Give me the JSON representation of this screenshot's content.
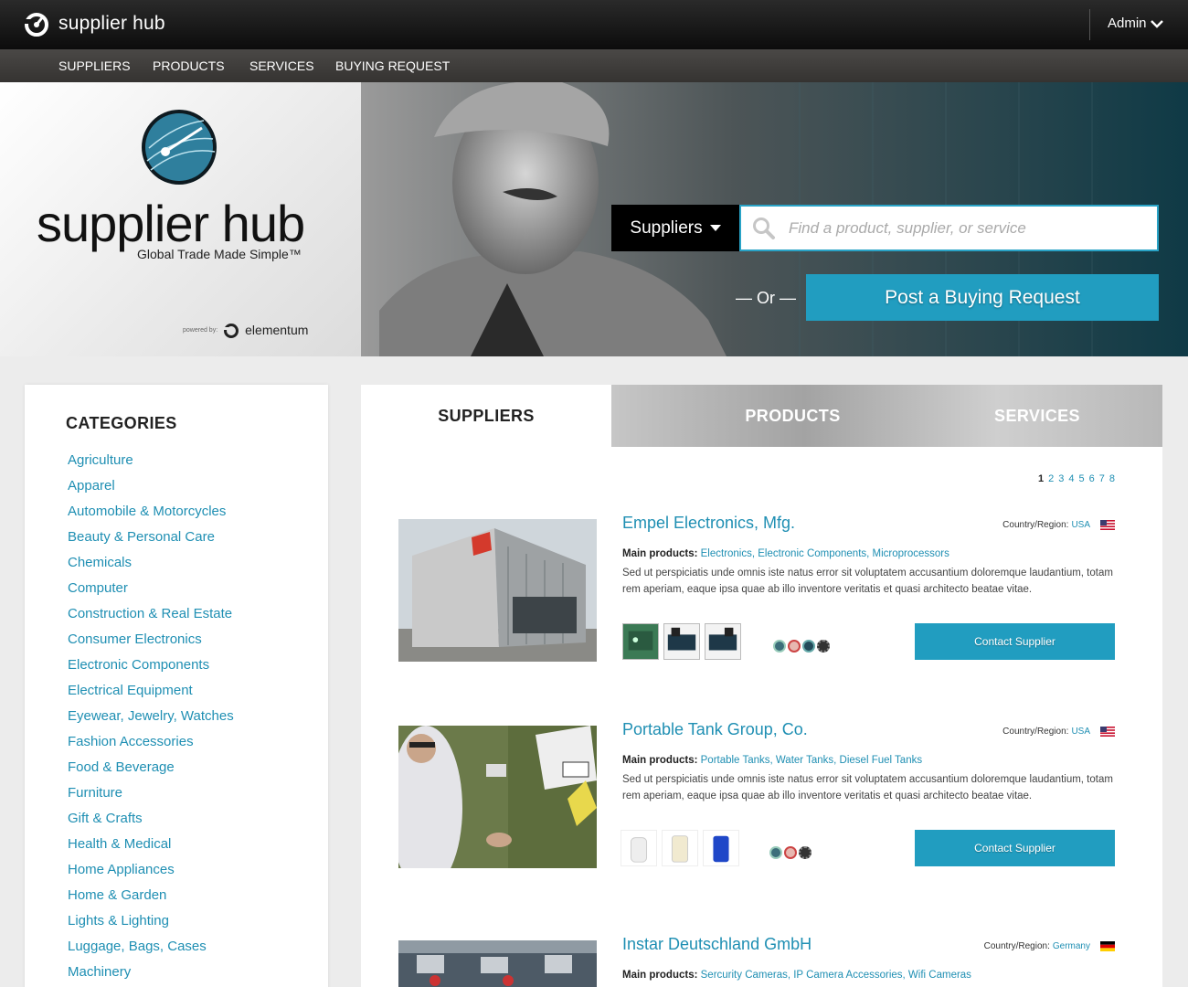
{
  "topbar": {
    "brand": "supplier hub",
    "user": "Admin"
  },
  "nav": {
    "items": [
      "SUPPLIERS",
      "PRODUCTS",
      "SERVICES",
      "BUYING REQUEST"
    ]
  },
  "hero": {
    "title": "supplier hub",
    "tagline": "Global Trade Made Simple™",
    "powered_label": "powered by:",
    "powered_name": "elementum",
    "search_type": "Suppliers",
    "search_placeholder": "Find a product, supplier, or service",
    "or_label": "— Or —",
    "post_button": "Post a Buying Request"
  },
  "sidebar": {
    "title": "CATEGORIES",
    "items": [
      "Agriculture",
      "Apparel",
      "Automobile & Motorcycles",
      "Beauty & Personal Care",
      "Chemicals",
      "Computer",
      "Construction & Real Estate",
      "Consumer Electronics",
      "Electronic Components",
      "Electrical Equipment",
      "Eyewear, Jewelry, Watches",
      "Fashion Accessories",
      "Food & Beverage",
      "Furniture",
      "Gift & Crafts",
      "Health & Medical",
      "Home Appliances",
      "Home & Garden",
      "Lights & Lighting",
      "Luggage, Bags, Cases",
      "Machinery"
    ]
  },
  "tabs": {
    "suppliers": "SUPPLIERS",
    "products": "PRODUCTS",
    "services": "SERVICES"
  },
  "pager": [
    "1",
    "2",
    "3",
    "4",
    "5",
    "6",
    "7",
    "8"
  ],
  "suppliers": [
    {
      "name": "Empel Electronics, Mfg.",
      "country_label": "Country/Region:",
      "country": "USA",
      "main_label": "Main products:",
      "products": "Electronics, Electronic Components, Microprocessors",
      "description": "Sed ut perspiciatis unde omnis iste natus error sit voluptatem accusantium doloremque laudantium, totam rem aperiam, eaque ipsa quae ab illo inventore veritatis et quasi architecto beatae vitae.",
      "contact": "Contact Supplier"
    },
    {
      "name": "Portable Tank Group, Co.",
      "country_label": "Country/Region:",
      "country": "USA",
      "main_label": "Main products:",
      "products": "Portable Tanks, Water Tanks, Diesel Fuel Tanks",
      "description": "Sed ut perspiciatis unde omnis iste natus error sit voluptatem accusantium doloremque laudantium, totam rem aperiam, eaque ipsa quae ab illo inventore veritatis et quasi architecto beatae vitae.",
      "contact": "Contact Supplier"
    },
    {
      "name": "Instar Deutschland GmbH",
      "country_label": "Country/Region:",
      "country": "Germany",
      "main_label": "Main products:",
      "products": "Sercurity Cameras, IP Camera Accessories, Wifi Cameras"
    }
  ],
  "colors": {
    "accent": "#219dc0",
    "link": "#1f8fb3",
    "topbar": "#111111",
    "nav": "#3d3b39"
  }
}
